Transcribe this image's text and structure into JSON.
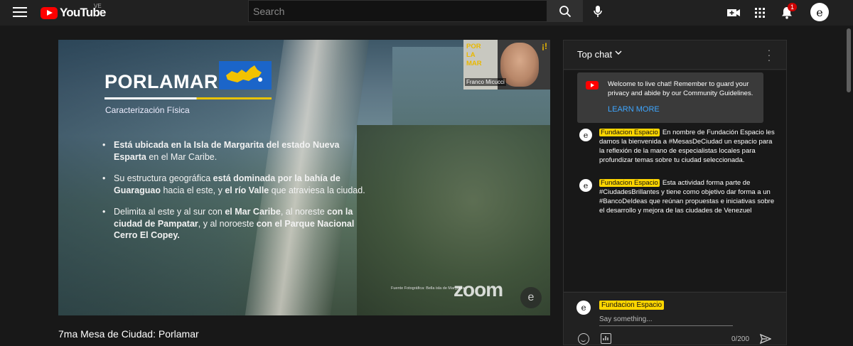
{
  "header": {
    "logo_text": "YouTube",
    "country_code": "VE",
    "search_placeholder": "Search",
    "notification_count": "1",
    "user_avatar_letter": "e"
  },
  "video": {
    "slide_title": "PORLAMAR",
    "slide_subtitle": "Caracterización Física",
    "bullets": [
      [
        {
          "t": "Está ubicada en la Isla de Margarita del estado Nueva Esparta",
          "b": true
        },
        {
          "t": " en el Mar Caribe.",
          "b": false
        }
      ],
      [
        {
          "t": "Su estructura geográfica ",
          "b": false
        },
        {
          "t": "está dominada por la bahía de Guaraguao",
          "b": true
        },
        {
          "t": " hacia el este, y ",
          "b": false
        },
        {
          "t": "el río Valle",
          "b": true
        },
        {
          "t": " que atraviesa la ciudad.",
          "b": false
        }
      ],
      [
        {
          "t": "Delimita al este y al sur con ",
          "b": false
        },
        {
          "t": "el Mar Caribe",
          "b": true
        },
        {
          "t": ", al noreste ",
          "b": false
        },
        {
          "t": "con la ciudad de Pampatar",
          "b": true
        },
        {
          "t": ", y al noroeste ",
          "b": false
        },
        {
          "t": "con el  Parque Nacional Cerro El Copey.",
          "b": true
        }
      ]
    ],
    "speaker_logo_lines": [
      "POR",
      "LA",
      "MAR"
    ],
    "speaker_excl": "¡!",
    "speaker_name": "Franco Micucci",
    "photo_credit": "Fuente Fotográfica: Bella isla de Margarita",
    "zoom_watermark": "zoom",
    "zoom_e": "e",
    "title": "7ma Mesa de Ciudad: Porlamar"
  },
  "chat": {
    "header_title": "Top chat",
    "welcome_text": "Welcome to live chat! Remember to guard your privacy and abide by our Community Guidelines.",
    "learn_more": "LEARN MORE",
    "messages": [
      {
        "author": "Fundacion Espacio",
        "avatar": "e",
        "text": "En nombre de Fundación Espacio les damos la bienvenida a #MesasDeCiudad un espacio para la reflexión de la mano de especialistas locales para profundizar temas sobre tu ciudad seleccionada."
      },
      {
        "author": "Fundacion Espacio",
        "avatar": "e",
        "text": "Esta actividad forma parte de #CiudadesBrillantes y tiene como objetivo dar forma a un #BancoDeIdeas que reúnan propuestas e iniciativas sobre el desarrollo y mejora de las ciudades de Venezuel"
      }
    ],
    "input_author": "Fundacion Espacio",
    "input_avatar": "e",
    "input_placeholder": "Say something...",
    "char_count": "0/200"
  },
  "colors": {
    "accent_red": "#ff0000",
    "author_highlight": "#ffd600",
    "link_blue": "#3ea6ff"
  }
}
